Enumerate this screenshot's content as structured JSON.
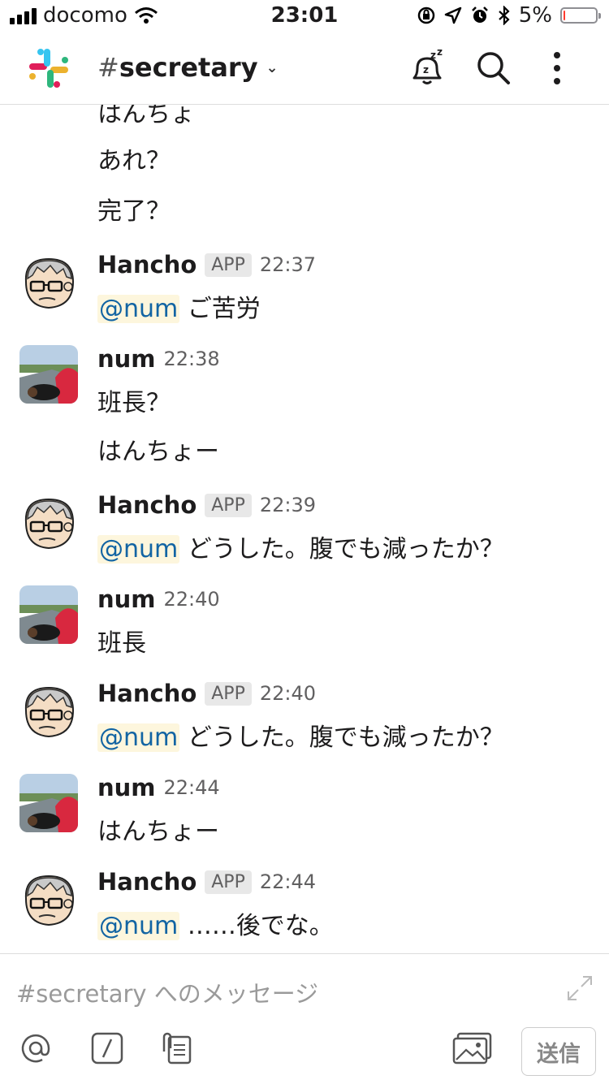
{
  "status_bar": {
    "carrier": "docomo",
    "time": "23:01",
    "battery": "5%",
    "battery_fraction": 0.05
  },
  "header": {
    "channel_hash": "#",
    "channel_name": "secretary"
  },
  "continuation": [
    {
      "text": "はんちょ"
    },
    {
      "text": "あれ？"
    },
    {
      "text": "完了？"
    }
  ],
  "messages": [
    {
      "name": "Hancho",
      "app_badge": "APP",
      "time": "22:37",
      "mention": "@num",
      "text": "ご苦労"
    },
    {
      "name": "num",
      "time": "22:38",
      "text": "班長？"
    },
    {
      "text": "はんちょー"
    },
    {
      "name": "Hancho",
      "app_badge": "APP",
      "time": "22:39",
      "mention": "@num",
      "text": "どうした。腹でも減ったか？"
    },
    {
      "name": "num",
      "time": "22:40",
      "text": "班長"
    },
    {
      "name": "Hancho",
      "app_badge": "APP",
      "time": "22:40",
      "mention": "@num",
      "text": "どうした。腹でも減ったか？"
    },
    {
      "name": "num",
      "time": "22:44",
      "text": "はんちょー"
    },
    {
      "name": "Hancho",
      "app_badge": "APP",
      "time": "22:44",
      "mention": "@num",
      "text": "……後でな。"
    }
  ],
  "composer": {
    "placeholder": "#secretary へのメッセージ",
    "send_label": "送信"
  },
  "icons": [
    "signal-icon",
    "wifi-icon",
    "rotation-lock-icon",
    "location-icon",
    "alarm-icon",
    "bluetooth-icon",
    "battery-icon",
    "slack-logo-icon",
    "snooze-bell-icon",
    "search-icon",
    "more-icon",
    "expand-icon",
    "mention-icon",
    "slash-icon",
    "attach-icon",
    "photo-icon"
  ]
}
